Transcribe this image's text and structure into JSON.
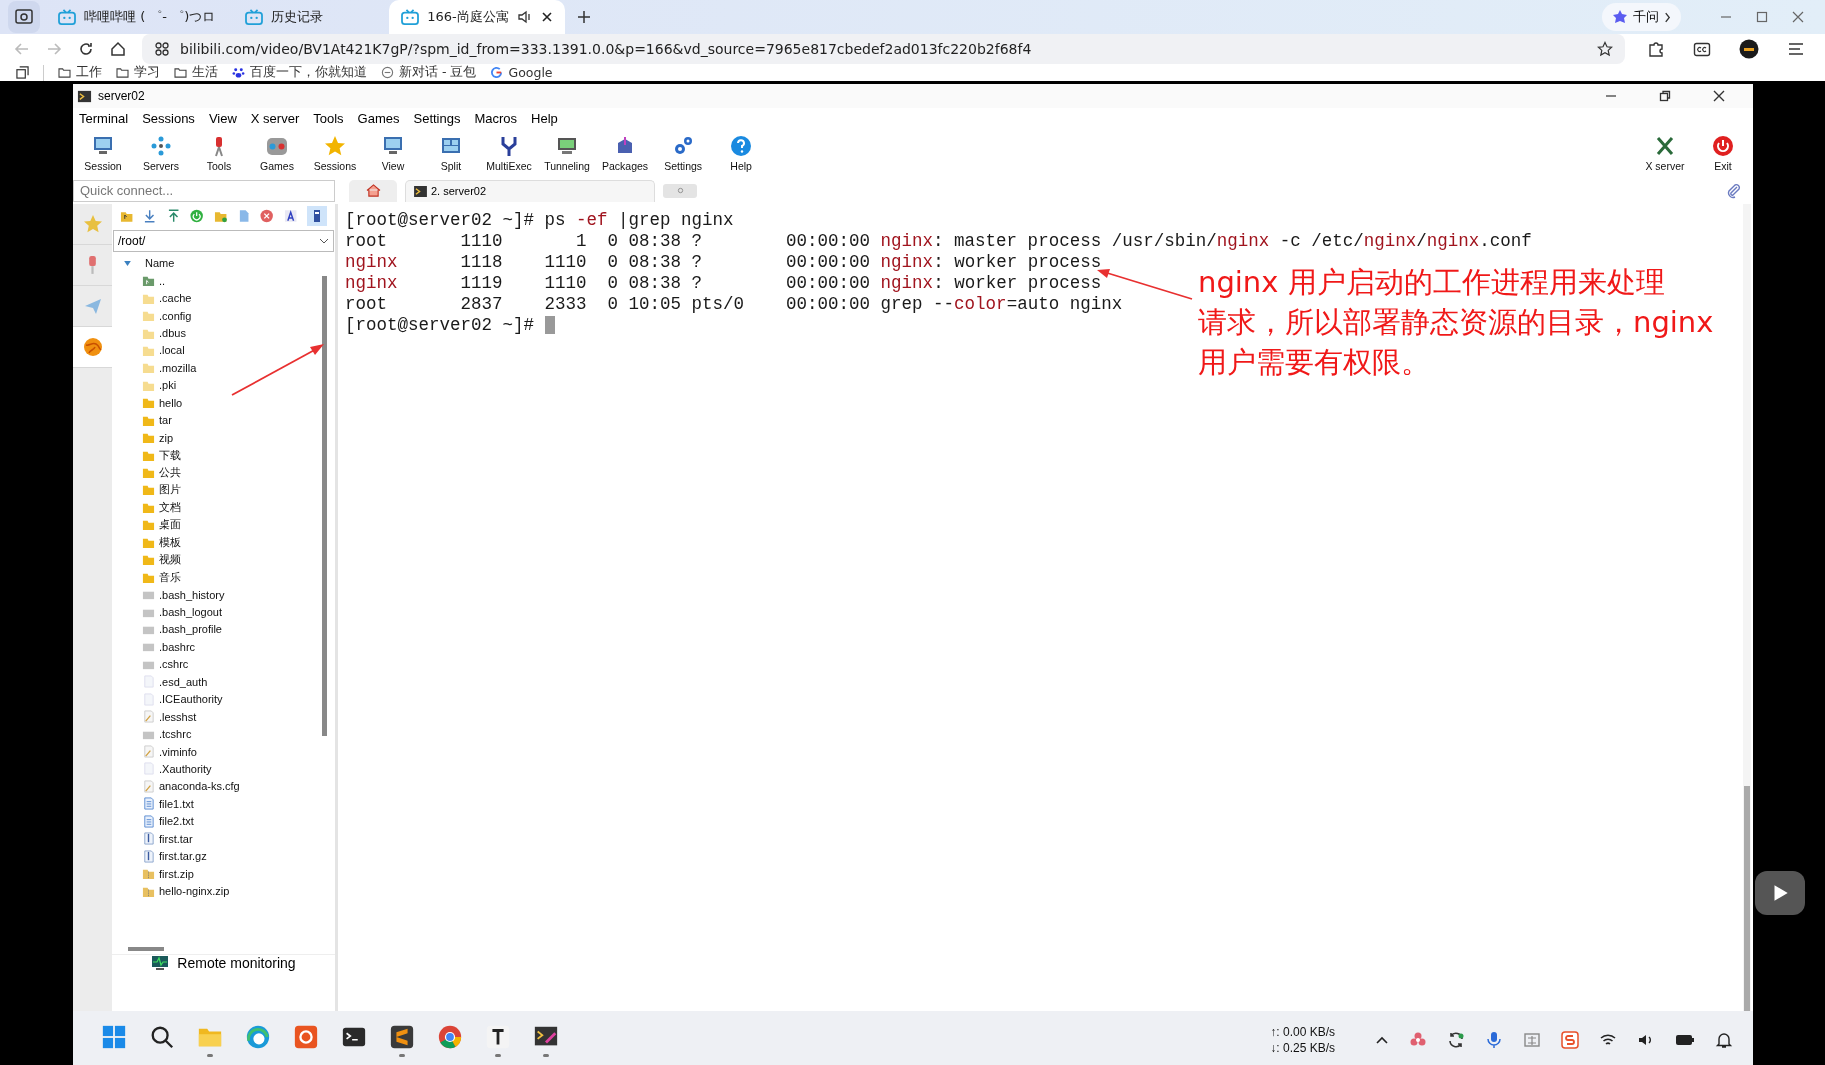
{
  "browser": {
    "tabs": [
      {
        "title": "哔哩哔哩 ( ゜- ゜)つロ",
        "selected": false,
        "audio": false
      },
      {
        "title": "历史记录",
        "selected": false,
        "audio": false
      },
      {
        "title": "166-尚庭公寓",
        "selected": true,
        "audio": true
      }
    ],
    "assistant_button": "千问",
    "url": "bilibili.com/video/BV1At421K7gP/?spm_id_from=333.1391.0.0&p=166&vd_source=7965e817cbedef2ad013fc220b2f68f4",
    "bookmarks": [
      {
        "label": "工作",
        "kind": "folder"
      },
      {
        "label": "学习",
        "kind": "folder"
      },
      {
        "label": "生活",
        "kind": "folder"
      },
      {
        "label": "百度一下，你就知道",
        "kind": "paw"
      },
      {
        "label": "新对话 - 豆包",
        "kind": "chat"
      },
      {
        "label": "Google",
        "kind": "google"
      }
    ]
  },
  "video": {
    "window": {
      "title": "server02"
    },
    "menu": [
      "Terminal",
      "Sessions",
      "View",
      "X server",
      "Tools",
      "Games",
      "Settings",
      "Macros",
      "Help"
    ],
    "toolbar": [
      "Session",
      "Servers",
      "Tools",
      "Games",
      "Sessions",
      "View",
      "Split",
      "MultiExec",
      "Tunneling",
      "Packages",
      "Settings",
      "Help"
    ],
    "toolbar_right": [
      "X server",
      "Exit"
    ],
    "sidebar_tabs": [
      {
        "selected": false
      },
      {
        "selected": false
      },
      {
        "selected": false
      },
      {
        "selected": true
      }
    ],
    "quick_connect": {
      "placeholder": "Quick connect..."
    },
    "session_tab": "2. server02",
    "file_panel": {
      "path": "/root/",
      "column": "Name",
      "files": [
        {
          "name": "..",
          "kind": "parent"
        },
        {
          "name": ".cache",
          "kind": "hidden-folder"
        },
        {
          "name": ".config",
          "kind": "hidden-folder"
        },
        {
          "name": ".dbus",
          "kind": "hidden-folder"
        },
        {
          "name": ".local",
          "kind": "hidden-folder"
        },
        {
          "name": ".mozilla",
          "kind": "hidden-folder"
        },
        {
          "name": ".pki",
          "kind": "hidden-folder"
        },
        {
          "name": "hello",
          "kind": "folder"
        },
        {
          "name": "tar",
          "kind": "folder"
        },
        {
          "name": "zip",
          "kind": "folder"
        },
        {
          "name": "下载",
          "kind": "folder"
        },
        {
          "name": "公共",
          "kind": "folder"
        },
        {
          "name": "图片",
          "kind": "folder"
        },
        {
          "name": "文档",
          "kind": "folder"
        },
        {
          "name": "桌面",
          "kind": "folder"
        },
        {
          "name": "模板",
          "kind": "folder"
        },
        {
          "name": "视频",
          "kind": "folder"
        },
        {
          "name": "音乐",
          "kind": "folder"
        },
        {
          "name": ".bash_history",
          "kind": "config-file"
        },
        {
          "name": ".bash_logout",
          "kind": "config-file"
        },
        {
          "name": ".bash_profile",
          "kind": "config-file"
        },
        {
          "name": ".bashrc",
          "kind": "config-file"
        },
        {
          "name": ".cshrc",
          "kind": "config-file"
        },
        {
          "name": ".esd_auth",
          "kind": "blank-file"
        },
        {
          "name": ".ICEauthority",
          "kind": "blank-file"
        },
        {
          "name": ".lesshst",
          "kind": "edit-file"
        },
        {
          "name": ".tcshrc",
          "kind": "config-file"
        },
        {
          "name": ".viminfo",
          "kind": "edit-file"
        },
        {
          "name": ".Xauthority",
          "kind": "blank-file"
        },
        {
          "name": "anaconda-ks.cfg",
          "kind": "edit-file"
        },
        {
          "name": "file1.txt",
          "kind": "text-file"
        },
        {
          "name": "file2.txt",
          "kind": "text-file"
        },
        {
          "name": "first.tar",
          "kind": "archive"
        },
        {
          "name": "first.tar.gz",
          "kind": "archive"
        },
        {
          "name": "first.zip",
          "kind": "zip"
        },
        {
          "name": "hello-nginx.zip",
          "kind": "zip"
        }
      ],
      "remote_monitoring": "Remote monitoring"
    },
    "terminal": {
      "lines": [
        [
          {
            "text": "[root@server02 ~]# ps ",
            "highlight": false
          },
          {
            "text": "-ef",
            "highlight": true
          },
          {
            "text": " |grep nginx",
            "highlight": false
          }
        ],
        [
          {
            "text": "root       1110       1  0 08:38 ?        00:00:00 ",
            "highlight": false
          },
          {
            "text": "nginx",
            "highlight": true
          },
          {
            "text": ": master process /usr/sbin/",
            "highlight": false
          },
          {
            "text": "nginx",
            "highlight": true
          },
          {
            "text": " -c /etc/",
            "highlight": false
          },
          {
            "text": "nginx",
            "highlight": true
          },
          {
            "text": "/",
            "highlight": false
          },
          {
            "text": "nginx",
            "highlight": true
          },
          {
            "text": ".conf",
            "highlight": false
          }
        ],
        [
          {
            "text": "nginx",
            "highlight": true
          },
          {
            "text": "      1118    1110  0 08:38 ?        00:00:00 ",
            "highlight": false
          },
          {
            "text": "nginx",
            "highlight": true
          },
          {
            "text": ": worker process",
            "highlight": false
          }
        ],
        [
          {
            "text": "nginx",
            "highlight": true
          },
          {
            "text": "      1119    1110  0 08:38 ?        00:00:00 ",
            "highlight": false
          },
          {
            "text": "nginx",
            "highlight": true
          },
          {
            "text": ": worker process",
            "highlight": false
          }
        ],
        [
          {
            "text": "root       2837    2333  0 10:05 pts/0    00:00:00 grep --",
            "highlight": false
          },
          {
            "text": "color",
            "highlight": true
          },
          {
            "text": "=auto nginx",
            "highlight": false
          }
        ],
        [
          {
            "text": "[root@server02 ~]# ",
            "highlight": false
          }
        ]
      ],
      "cursor": true
    },
    "annotation_lines": [
      "nginx 用户启动的工作进程用来处理",
      "请求，所以部署静态资源的目录，nginx",
      "用户需要有权限。"
    ],
    "taskbar": {
      "apps": [
        {
          "kind": "start",
          "running": false
        },
        {
          "kind": "search",
          "running": false
        },
        {
          "kind": "explorer",
          "running": true
        },
        {
          "kind": "edge",
          "running": false
        },
        {
          "kind": "ubuntu",
          "running": false
        },
        {
          "kind": "terminal",
          "running": false
        },
        {
          "kind": "sublime",
          "running": true
        },
        {
          "kind": "chrome",
          "running": false
        },
        {
          "kind": "typora",
          "running": true
        },
        {
          "kind": "mobaxterm",
          "running": true
        }
      ],
      "upload": "↑: 0.00 KB/s",
      "download": "↓: 0.25 KB/s"
    }
  }
}
